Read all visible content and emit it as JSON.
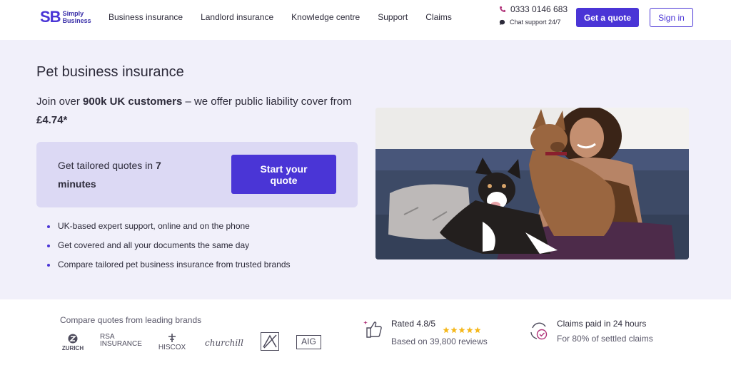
{
  "brand": {
    "logo_mark": "SB",
    "logo_line1": "Simply",
    "logo_line2": "Business",
    "accent": "#4a35d6"
  },
  "nav": {
    "items": [
      "Business insurance",
      "Landlord insurance",
      "Knowledge centre",
      "Support",
      "Claims"
    ]
  },
  "contact": {
    "phone": "0333 0146 683",
    "chat": "Chat support 24/7",
    "phone_icon": "phone-icon",
    "chat_icon": "chat-icon"
  },
  "header_buttons": {
    "quote": "Get a quote",
    "signin": "Sign in"
  },
  "hero": {
    "title": "Pet business insurance",
    "lead_prefix": "Join over ",
    "lead_bold": "900k UK customers",
    "lead_mid": " – we offer public liability cover from ",
    "lead_price": "£4.74*",
    "cta_prefix": "Get tailored quotes in ",
    "cta_bold": "7 minutes",
    "cta_button": "Start your quote",
    "bullets": [
      "UK-based expert support, online and on the phone",
      "Get covered and all your documents the same day",
      "Compare tailored pet business insurance from trusted brands"
    ],
    "background": "#f1f0fa",
    "cta_background": "#dcd9f4"
  },
  "brands": {
    "label": "Compare quotes from leading brands",
    "items": [
      "ZURICH",
      "RSA INSURANCE",
      "HISCOX",
      "churchill",
      "AXA",
      "AIG"
    ]
  },
  "rating": {
    "title": "Rated 4.8/5",
    "subtitle": "Based on 39,800 reviews",
    "stars": 5,
    "star_color": "#f5b81c"
  },
  "claims": {
    "title": "Claims paid in 24 hours",
    "subtitle": "For 80% of settled claims"
  }
}
